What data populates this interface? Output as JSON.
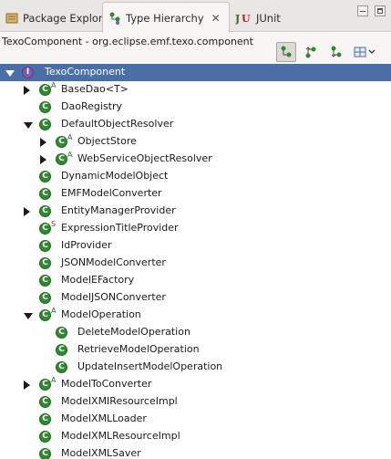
{
  "tabs": {
    "package_explorer": "Package Explorer",
    "type_hierarchy": "Type Hierarchy",
    "junit": "JUnit"
  },
  "toolbar": {
    "context": "TexoComponent - org.eclipse.emf.texo.component"
  },
  "colors": {
    "selection": "#4a6ea6",
    "class_icon": "#2f8a2f",
    "interface_icon": "#7d5aa8"
  },
  "tree": [
    {
      "label": "TexoComponent",
      "kind": "interface",
      "twisty": "expanded",
      "selected": true
    },
    {
      "label": "BaseDao<T>",
      "kind": "class",
      "mod": "A",
      "twisty": "collapsed"
    },
    {
      "label": "DaoRegistry",
      "kind": "class"
    },
    {
      "label": "DefaultObjectResolver",
      "kind": "class",
      "twisty": "expanded"
    },
    {
      "label": "ObjectStore",
      "kind": "class",
      "mod": "A",
      "twisty": "collapsed"
    },
    {
      "label": "WebServiceObjectResolver",
      "kind": "class",
      "mod": "A",
      "twisty": "collapsed"
    },
    {
      "label": "DynamicModelObject",
      "kind": "class"
    },
    {
      "label": "EMFModelConverter",
      "kind": "class"
    },
    {
      "label": "EntityManagerProvider",
      "kind": "class",
      "twisty": "collapsed"
    },
    {
      "label": "ExpressionTitleProvider",
      "kind": "class",
      "mod": "S"
    },
    {
      "label": "IdProvider",
      "kind": "class"
    },
    {
      "label": "JSONModelConverter",
      "kind": "class"
    },
    {
      "label": "ModelEFactory",
      "kind": "class"
    },
    {
      "label": "ModelJSONConverter",
      "kind": "class"
    },
    {
      "label": "ModelOperation",
      "kind": "class",
      "mod": "A",
      "twisty": "expanded"
    },
    {
      "label": "DeleteModelOperation",
      "kind": "class"
    },
    {
      "label": "RetrieveModelOperation",
      "kind": "class"
    },
    {
      "label": "UpdateInsertModelOperation",
      "kind": "class"
    },
    {
      "label": "ModelToConverter",
      "kind": "class",
      "mod": "A",
      "twisty": "collapsed"
    },
    {
      "label": "ModelXMIResourceImpl",
      "kind": "class"
    },
    {
      "label": "ModelXMLLoader",
      "kind": "class"
    },
    {
      "label": "ModelXMLResourceImpl",
      "kind": "class"
    },
    {
      "label": "ModelXMLSaver",
      "kind": "class"
    }
  ]
}
